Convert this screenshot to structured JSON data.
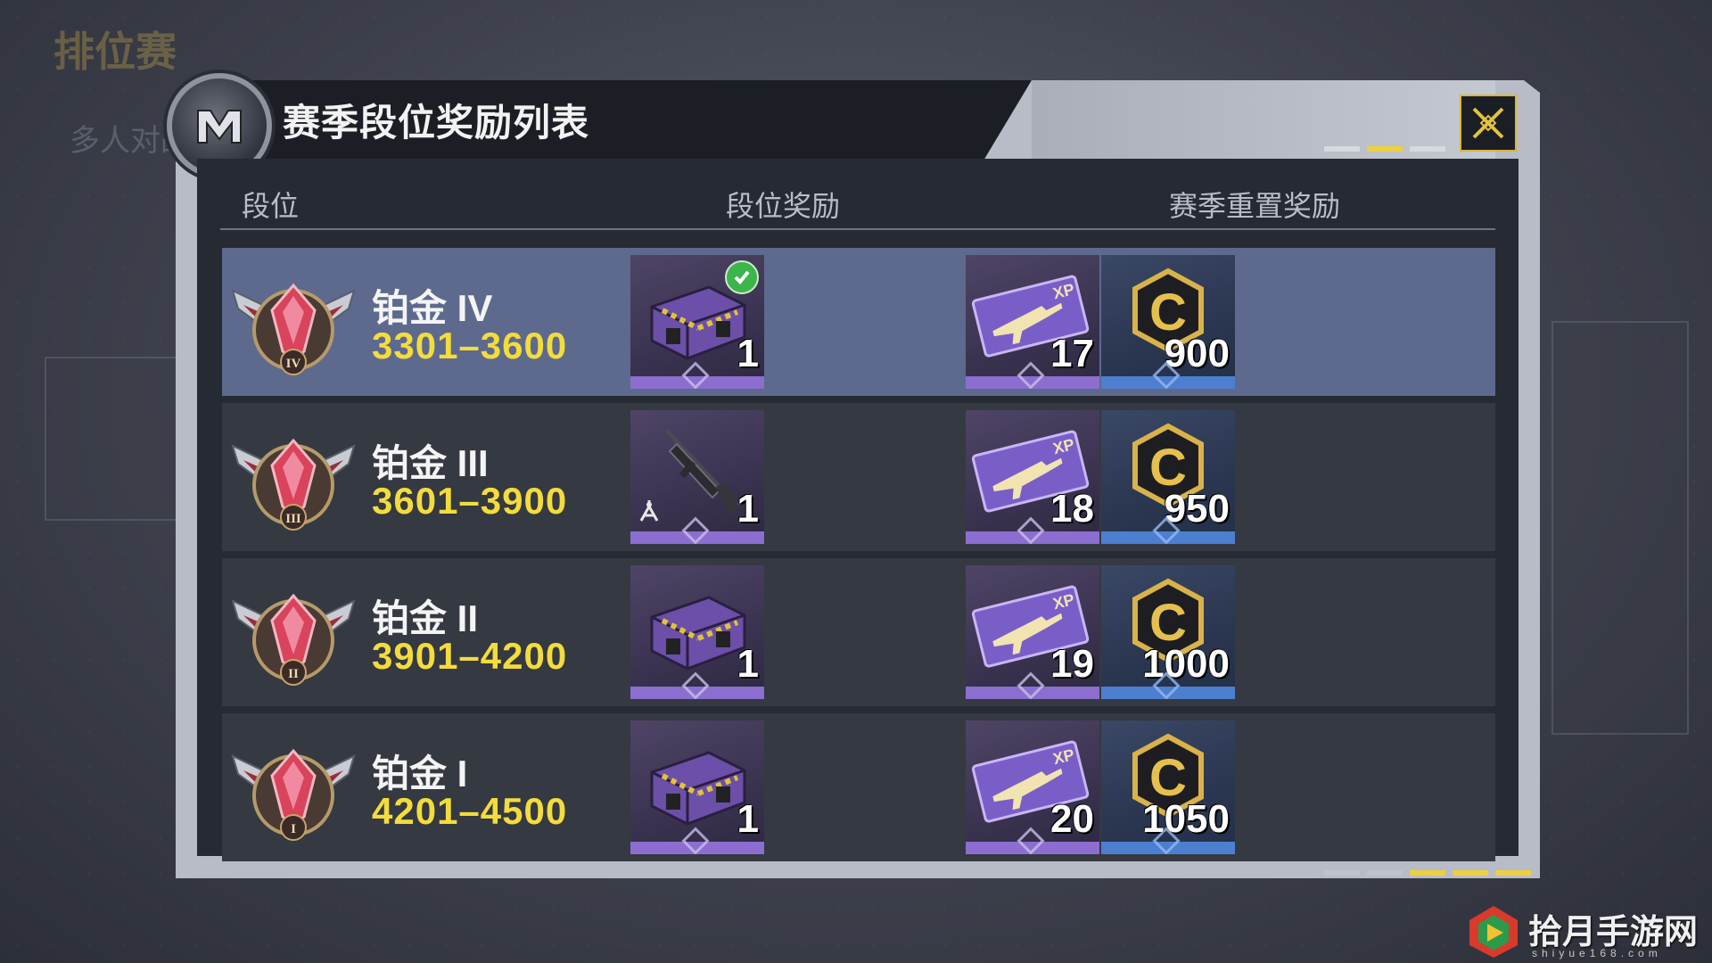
{
  "background": {
    "title": "排位赛",
    "subtitle": "多人对战"
  },
  "modal": {
    "title": "赛季段位奖励列表",
    "close_icon": "close-x-icon",
    "columns": [
      "段位",
      "段位奖励",
      "赛季重置奖励"
    ],
    "rows": [
      {
        "name": "铂金 IV",
        "range": "3301–3600",
        "rank_reward_qty": "1",
        "rank_reward_icon": "supply-crate-icon",
        "claimed": true,
        "xp_qty": "17",
        "cp_qty": "900",
        "selected": true
      },
      {
        "name": "铂金 III",
        "range": "3601–3900",
        "rank_reward_qty": "1",
        "rank_reward_icon": "assault-rifle-icon",
        "claimed": false,
        "xp_qty": "18",
        "cp_qty": "950",
        "selected": false
      },
      {
        "name": "铂金 II",
        "range": "3901–4200",
        "rank_reward_qty": "1",
        "rank_reward_icon": "supply-crate-icon",
        "claimed": false,
        "xp_qty": "19",
        "cp_qty": "1000",
        "selected": false
      },
      {
        "name": "铂金 I",
        "range": "4201–4500",
        "rank_reward_qty": "1",
        "rank_reward_icon": "supply-crate-icon",
        "claimed": false,
        "xp_qty": "20",
        "cp_qty": "1050",
        "selected": false
      }
    ]
  },
  "watermark": {
    "text": "拾月手游网",
    "sub": "shiyue168.com"
  },
  "colors": {
    "accent_gold": "#f3dc3c",
    "selected_row": "#5d6a8e",
    "purple_bar": "#8b6ed0",
    "blue_bar": "#4d7fd1",
    "check_green": "#3cb54a"
  }
}
